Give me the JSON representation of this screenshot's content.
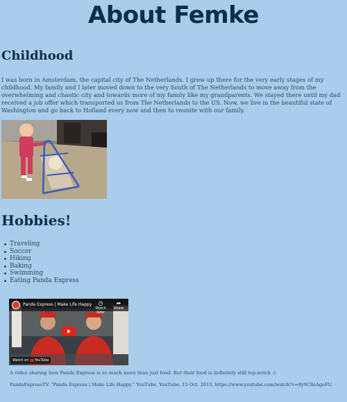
{
  "page": {
    "title": "About Femke"
  },
  "childhood": {
    "heading": "Childhood",
    "text": "I was born in Amsterdam, the capital city of The Netherlands. I grew up there for the very early stages of my childhood. My family and I later moved down to the very South of The Netherlands to move away from the overwhelming and chaotic city and towards more of my family like my grandparents. We stayed there until my dad received a job offer which transported us from The Netherlands to the US. Now, we live in the beautiful state of Washington and go back to Holland every now and then to reunite with our family."
  },
  "hobbies": {
    "heading": "Hobbies!",
    "items": [
      "Traveling",
      "Soccer",
      "Hiking",
      "Baking",
      "Swimming",
      "Eating Panda Express"
    ]
  },
  "video": {
    "title": "Panda Express | Make Life Happy",
    "watch_later": "Watch later",
    "share": "Share",
    "watch_on": "Watch on",
    "youtube": "YouTube",
    "caption": "A video sharing how Panda Express is so much more than just food. But their food is definitely still top-notch :)",
    "citation": "PandaExpressTV. “Panda Express | Make Life Happy.” YouTube, YouTube, 15 Oct. 2013, https://www.youtube.com/watch?v=8y9C8eAgeFU."
  },
  "colors": {
    "background": "#a9cdea",
    "heading": "#102e47",
    "text": "#274a63"
  }
}
